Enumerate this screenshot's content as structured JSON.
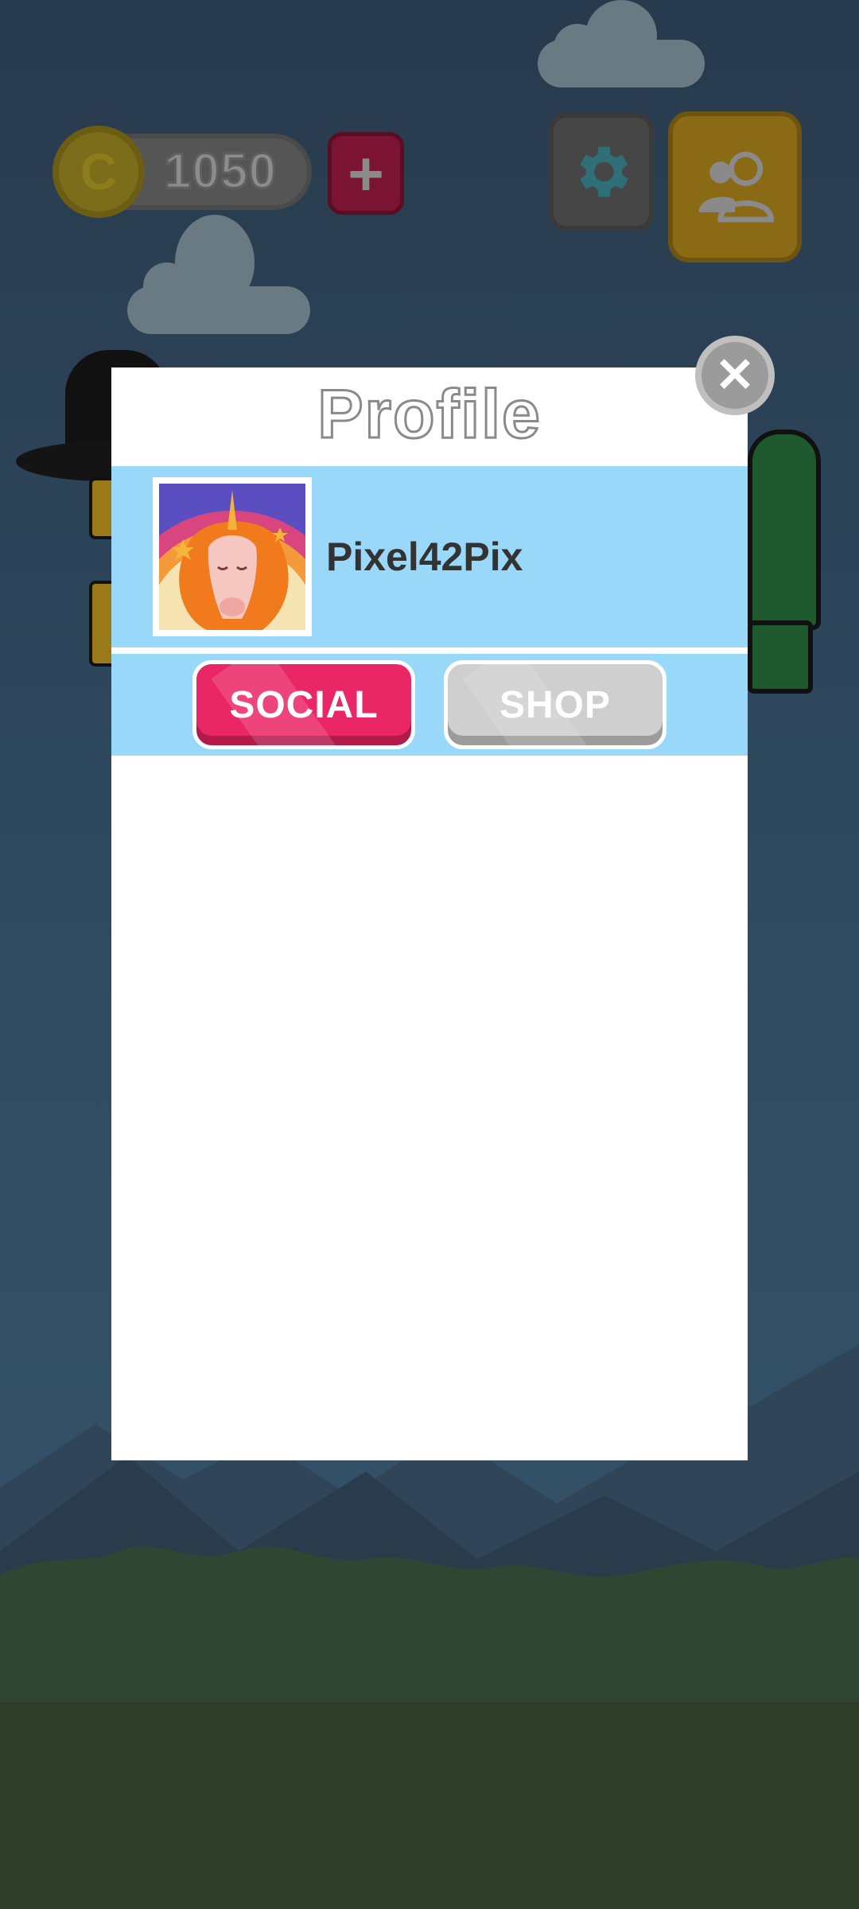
{
  "hud": {
    "coins": "1050",
    "coin_icon": "coin-icon",
    "add_coins_icon": "plus-icon",
    "settings_icon": "gear-icon",
    "profile_icon": "users-icon"
  },
  "modal": {
    "title": "Profile",
    "close_icon": "close-icon",
    "username": "Pixel42Pix",
    "avatar": "unicorn-avatar",
    "tabs": [
      {
        "label": "SOCIAL",
        "active": true
      },
      {
        "label": "SHOP",
        "active": false
      }
    ]
  },
  "colors": {
    "accent_pink": "#ea2766",
    "band_blue": "#9ad8fa",
    "inactive_gray": "#cfcfcf"
  }
}
